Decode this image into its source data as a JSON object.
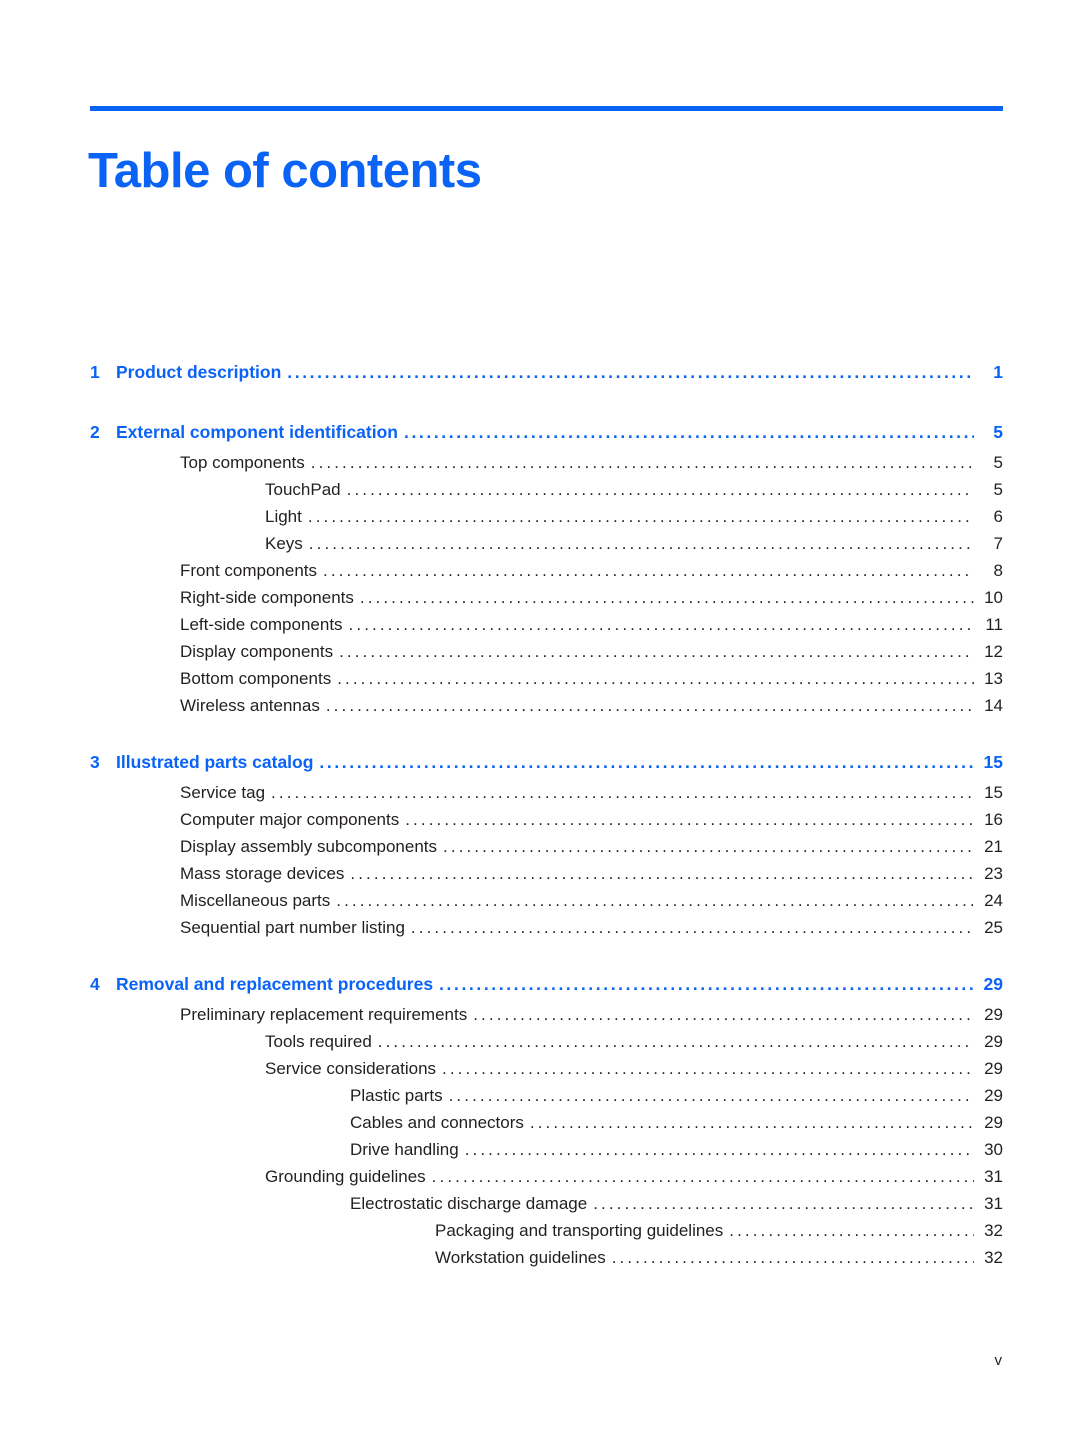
{
  "document": {
    "title": "Table of contents",
    "folio": "v",
    "accent_color": "#0b63f6",
    "text_color": "#231f20"
  },
  "toc": {
    "entries": [
      {
        "level": 1,
        "number": "1",
        "label": "Product description",
        "page": "1"
      },
      {
        "level": 1,
        "number": "2",
        "label": "External component identification",
        "page": "5"
      },
      {
        "level": 2,
        "number": "",
        "label": "Top components",
        "page": "5"
      },
      {
        "level": 3,
        "number": "",
        "label": "TouchPad",
        "page": "5"
      },
      {
        "level": 3,
        "number": "",
        "label": "Light",
        "page": "6"
      },
      {
        "level": 3,
        "number": "",
        "label": "Keys",
        "page": "7"
      },
      {
        "level": 2,
        "number": "",
        "label": "Front components",
        "page": "8"
      },
      {
        "level": 2,
        "number": "",
        "label": "Right-side components",
        "page": "10"
      },
      {
        "level": 2,
        "number": "",
        "label": "Left-side components",
        "page": "11"
      },
      {
        "level": 2,
        "number": "",
        "label": "Display components",
        "page": "12"
      },
      {
        "level": 2,
        "number": "",
        "label": "Bottom components",
        "page": "13"
      },
      {
        "level": 2,
        "number": "",
        "label": "Wireless antennas",
        "page": "14"
      },
      {
        "level": 1,
        "number": "3",
        "label": "Illustrated parts catalog",
        "page": "15"
      },
      {
        "level": 2,
        "number": "",
        "label": "Service tag",
        "page": "15"
      },
      {
        "level": 2,
        "number": "",
        "label": "Computer major components",
        "page": "16"
      },
      {
        "level": 2,
        "number": "",
        "label": "Display assembly subcomponents",
        "page": "21"
      },
      {
        "level": 2,
        "number": "",
        "label": "Mass storage devices",
        "page": "23"
      },
      {
        "level": 2,
        "number": "",
        "label": "Miscellaneous parts",
        "page": "24"
      },
      {
        "level": 2,
        "number": "",
        "label": "Sequential part number listing",
        "page": "25"
      },
      {
        "level": 1,
        "number": "4",
        "label": "Removal and replacement procedures",
        "page": "29"
      },
      {
        "level": 2,
        "number": "",
        "label": "Preliminary replacement requirements",
        "page": "29"
      },
      {
        "level": 3,
        "number": "",
        "label": "Tools required",
        "page": "29"
      },
      {
        "level": 3,
        "number": "",
        "label": "Service considerations",
        "page": "29"
      },
      {
        "level": 4,
        "number": "",
        "label": "Plastic parts",
        "page": "29"
      },
      {
        "level": 4,
        "number": "",
        "label": "Cables and connectors",
        "page": "29"
      },
      {
        "level": 4,
        "number": "",
        "label": "Drive handling",
        "page": "30"
      },
      {
        "level": 3,
        "number": "",
        "label": "Grounding guidelines",
        "page": "31"
      },
      {
        "level": 4,
        "number": "",
        "label": "Electrostatic discharge damage",
        "page": "31"
      },
      {
        "level": 5,
        "number": "",
        "label": "Packaging and transporting guidelines",
        "page": "32"
      },
      {
        "level": 5,
        "number": "",
        "label": "Workstation guidelines",
        "page": "32"
      }
    ]
  }
}
